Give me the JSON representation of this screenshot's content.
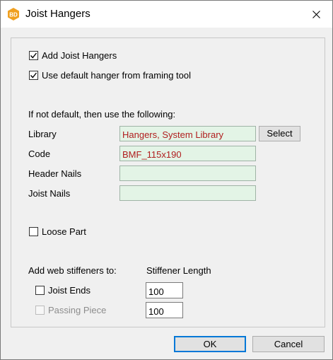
{
  "window": {
    "title": "Joist Hangers",
    "icon_text": "BD",
    "icon_color": "#f0a020"
  },
  "options": {
    "add_joist_hangers": {
      "label": "Add Joist Hangers",
      "checked": true
    },
    "use_default_hanger": {
      "label": "Use default hanger from framing tool",
      "checked": true
    }
  },
  "fields": {
    "instruction": "If not default, then use the following:",
    "library": {
      "label": "Library",
      "value": "Hangers, System Library"
    },
    "code": {
      "label": "Code",
      "value": "BMF_115x190"
    },
    "header_nails": {
      "label": "Header Nails",
      "value": ""
    },
    "joist_nails": {
      "label": "Joist Nails",
      "value": ""
    },
    "select_label": "Select"
  },
  "loose_part": {
    "label": "Loose Part",
    "checked": false
  },
  "stiffeners": {
    "heading": "Add web stiffeners to:",
    "length_heading": "Stiffener Length",
    "joist_ends": {
      "label": "Joist Ends",
      "checked": false,
      "length": "100"
    },
    "passing_piece": {
      "label": "Passing Piece",
      "checked": false,
      "enabled": false,
      "length": "100"
    }
  },
  "buttons": {
    "ok": "OK",
    "cancel": "Cancel"
  }
}
